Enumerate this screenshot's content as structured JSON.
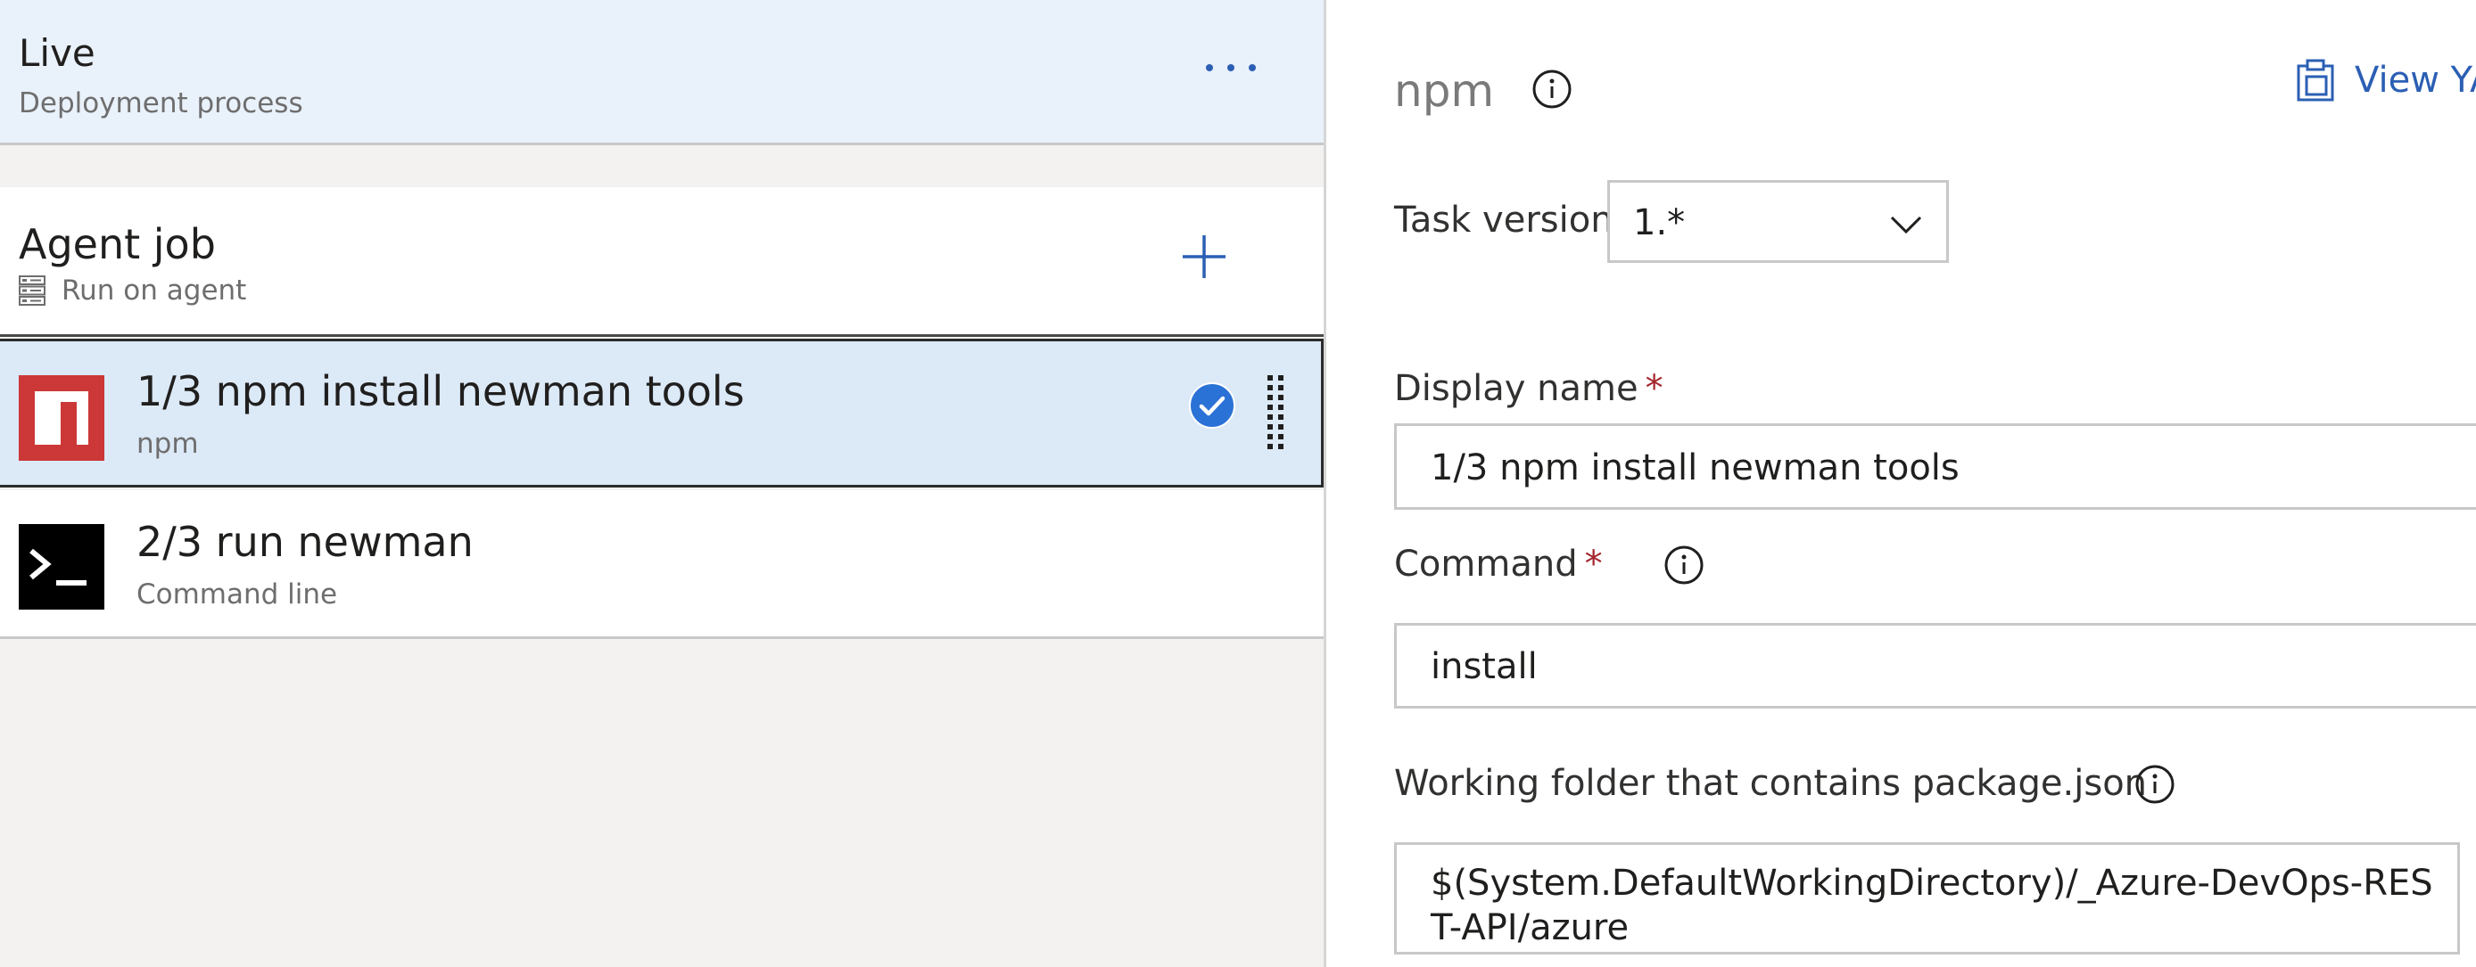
{
  "stage": {
    "title": "Live",
    "subtitle": "Deployment process"
  },
  "agent_job": {
    "title": "Agent job",
    "subtitle": "Run on agent"
  },
  "tasks": [
    {
      "title": "1/3 npm install newman tools",
      "subtitle": "npm",
      "selected": true,
      "icon": "npm-icon"
    },
    {
      "title": "2/3 run newman",
      "subtitle": "Command line",
      "selected": false,
      "icon": "command-line-icon"
    }
  ],
  "panel": {
    "title": "npm",
    "view_yaml_label": "View YAML",
    "task_version_label": "Task version",
    "task_version_value": "1.*",
    "display_name_label": "Display name",
    "display_name_value": "1/3 npm install newman tools",
    "command_label": "Command",
    "command_value": "install",
    "working_folder_label": "Working folder that contains package.json",
    "working_folder_value": "$(System.DefaultWorkingDirectory)/_Azure-DevOps-REST-API/azure",
    "required_marker": "*"
  },
  "colors": {
    "accent": "#2b5fb4",
    "header_bg": "#e9f1fa",
    "selected_bg": "#dce9f7",
    "npm_red": "#cb3837",
    "required": "#a4262c"
  }
}
